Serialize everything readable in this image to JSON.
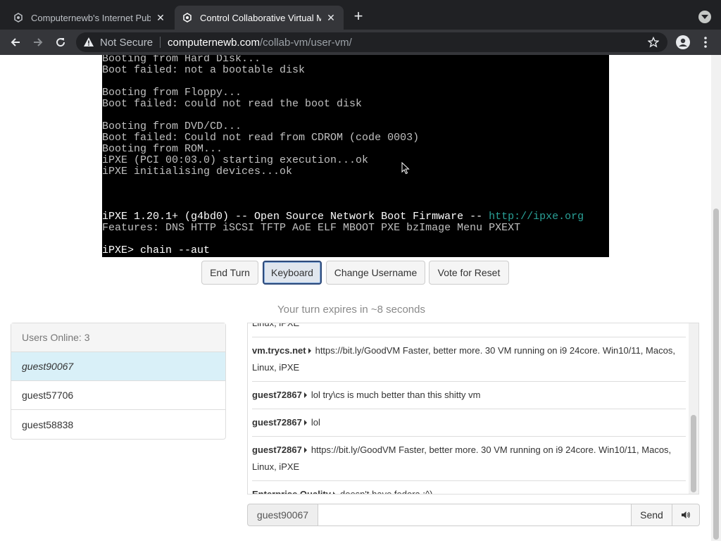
{
  "browser": {
    "tabs": [
      {
        "title": "Computernewb's Internet Pub",
        "active": false
      },
      {
        "title": "Control Collaborative Virtual M",
        "active": true
      }
    ],
    "address": {
      "security_label": "Not Secure",
      "host": "computernewb.com",
      "path": "/collab-vm/user-vm/"
    }
  },
  "vm_console": {
    "lines": [
      {
        "text": "Booting from Hard Disk...",
        "style": "normal"
      },
      {
        "text": "Boot failed: not a bootable disk",
        "style": "normal"
      },
      {
        "text": "",
        "style": "normal"
      },
      {
        "text": "Booting from Floppy...",
        "style": "normal"
      },
      {
        "text": "Boot failed: could not read the boot disk",
        "style": "normal"
      },
      {
        "text": "",
        "style": "normal"
      },
      {
        "text": "Booting from DVD/CD...",
        "style": "normal"
      },
      {
        "text": "Boot failed: Could not read from CDROM (code 0003)",
        "style": "normal"
      },
      {
        "text": "Booting from ROM...",
        "style": "normal"
      },
      {
        "text": "iPXE (PCI 00:03.0) starting execution...ok",
        "style": "normal"
      },
      {
        "text": "iPXE initialising devices...ok",
        "style": "normal"
      },
      {
        "text": "",
        "style": "normal"
      },
      {
        "text": "",
        "style": "normal"
      },
      {
        "text": "",
        "style": "normal"
      },
      {
        "text": "iPXE 1.20.1+ (g4bd0) -- Open Source Network Boot Firmware -- ",
        "style": "bright",
        "link": "http://ipxe.org"
      },
      {
        "text": "Features: DNS HTTP iSCSI TFTP AoE ELF MBOOT PXE bzImage Menu PXEXT",
        "style": "normal"
      },
      {
        "text": "",
        "style": "normal"
      },
      {
        "text": "iPXE> chain --aut",
        "style": "bright"
      }
    ]
  },
  "controls": {
    "end_turn": "End Turn",
    "keyboard": "Keyboard",
    "change_username": "Change Username",
    "vote_reset": "Vote for Reset"
  },
  "turn_status": "Your turn expires in ~8 seconds",
  "users": {
    "header": "Users Online: 3",
    "list": [
      "guest90067",
      "guest57706",
      "guest58838"
    ]
  },
  "chat": {
    "messages": [
      {
        "user": "",
        "text": "Linux, iPXE"
      },
      {
        "user": "vm.trycs.net",
        "text": "https://bit.ly/GoodVM Faster, better more. 30 VM running on i9 24core. Win10/11, Macos, Linux, iPXE"
      },
      {
        "user": "guest72867",
        "text": "lol try\\cs is much better than this shitty vm"
      },
      {
        "user": "guest72867",
        "text": "lol"
      },
      {
        "user": "guest72867",
        "text": "https://bit.ly/GoodVM Faster, better more. 30 VM running on i9 24core. Win10/11, Macos, Linux, iPXE"
      },
      {
        "user": "Enterprise Quality",
        "text": "doesn't have fedora :^)"
      }
    ],
    "username": "guest90067",
    "input_value": "",
    "send_label": "Send"
  },
  "colors": {
    "chrome_dark": "#202124",
    "chrome_toolbar": "#35363a",
    "console_bg": "#000000",
    "console_text": "#c0c0c0",
    "console_link": "#2aa198",
    "active_user_bg": "#d9f0f8"
  }
}
